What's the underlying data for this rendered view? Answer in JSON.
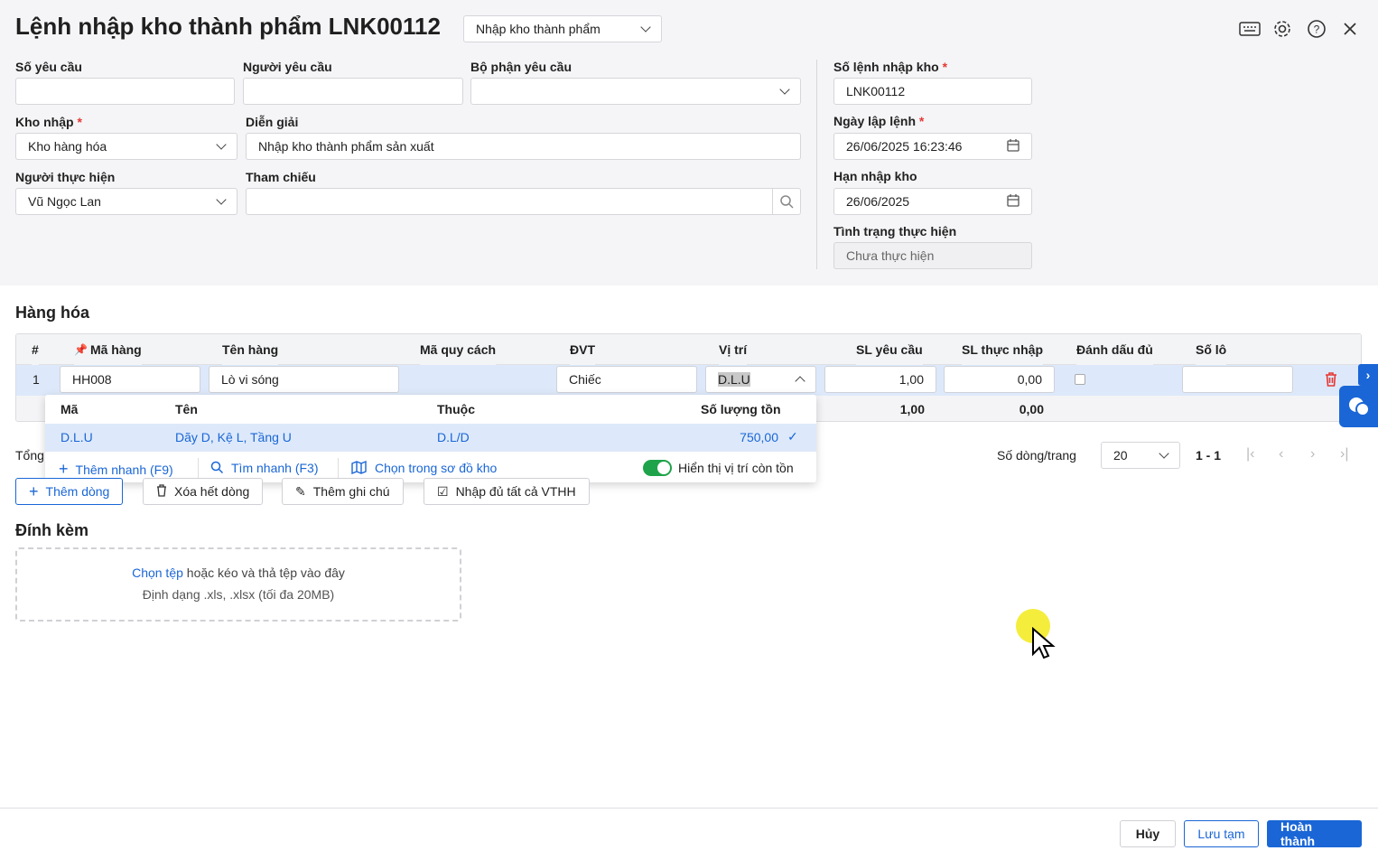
{
  "header": {
    "title": "Lệnh nhập kho thành phẩm LNK00112",
    "type_select": "Nhập kho thành phẩm"
  },
  "form": {
    "so_yeu_cau": {
      "label": "Số yêu cầu",
      "value": ""
    },
    "nguoi_yeu_cau": {
      "label": "Người yêu cầu",
      "value": ""
    },
    "bo_phan": {
      "label": "Bộ phận yêu cầu",
      "value": ""
    },
    "kho_nhap": {
      "label": "Kho nhập",
      "required": "*",
      "value": "Kho hàng hóa"
    },
    "dien_giai": {
      "label": "Diễn giải",
      "value": "Nhập kho thành phẩm sản xuất"
    },
    "nguoi_thuc_hien": {
      "label": "Người thực hiện",
      "value": "Vũ Ngọc Lan"
    },
    "tham_chieu": {
      "label": "Tham chiếu",
      "value": ""
    },
    "so_lenh": {
      "label": "Số lệnh nhập kho",
      "required": "*",
      "value": "LNK00112"
    },
    "ngay_lap": {
      "label": "Ngày lập lệnh",
      "required": "*",
      "value": "26/06/2025 16:23:46"
    },
    "han_nhap": {
      "label": "Hạn nhập kho",
      "value": "26/06/2025"
    },
    "tinh_trang": {
      "label": "Tình trạng thực hiện",
      "value": "Chưa thực hiện"
    }
  },
  "goods": {
    "title": "Hàng hóa",
    "columns": [
      "#",
      "Mã hàng",
      "Tên hàng",
      "Mã quy cách",
      "ĐVT",
      "Vị trí",
      "SL yêu cầu",
      "SL thực nhập",
      "Đánh dấu đủ",
      "Số lô"
    ],
    "row": {
      "index": "1",
      "ma": "HH008",
      "ten": "Lò vi sóng",
      "dvt": "Chiếc",
      "vi_tri": "D.L.U",
      "sl_yc": "1,00",
      "sl_tn": "0,00"
    },
    "totals": {
      "label": "Tổng",
      "sl_yc": "1,00",
      "sl_tn": "0,00"
    },
    "dropdown": {
      "headers": [
        "Mã",
        "Tên",
        "Thuộc",
        "Số lượng tồn"
      ],
      "item": {
        "ma": "D.L.U",
        "ten": "Dãy D, Kệ L, Tầng U",
        "thuoc": "D.L/D",
        "ton": "750,00"
      },
      "quick_add": "Thêm nhanh (F9)",
      "quick_search": "Tìm nhanh (F3)",
      "map": "Chọn trong sơ đồ kho",
      "toggle": "Hiển thị vị trí còn tồn"
    },
    "buttons": {
      "add": "Thêm dòng",
      "clear": "Xóa hết dòng",
      "note": "Thêm ghi chú",
      "fill": "Nhập đủ tất cả VTHH"
    },
    "pager": {
      "label": "Số dòng/trang",
      "size": "20",
      "range": "1 - 1"
    }
  },
  "attach": {
    "title": "Đính kèm",
    "link": "Chọn tệp",
    "text": " hoặc kéo và thả tệp vào đây",
    "hint": "Định dạng .xls, .xlsx (tối đa 20MB)"
  },
  "footer": {
    "cancel": "Hủy",
    "save_draft": "Lưu tạm",
    "finish": "Hoàn thành"
  },
  "colors": {
    "accent": "#1a66d6",
    "danger": "#e53935",
    "toggle": "#1fa34a"
  }
}
